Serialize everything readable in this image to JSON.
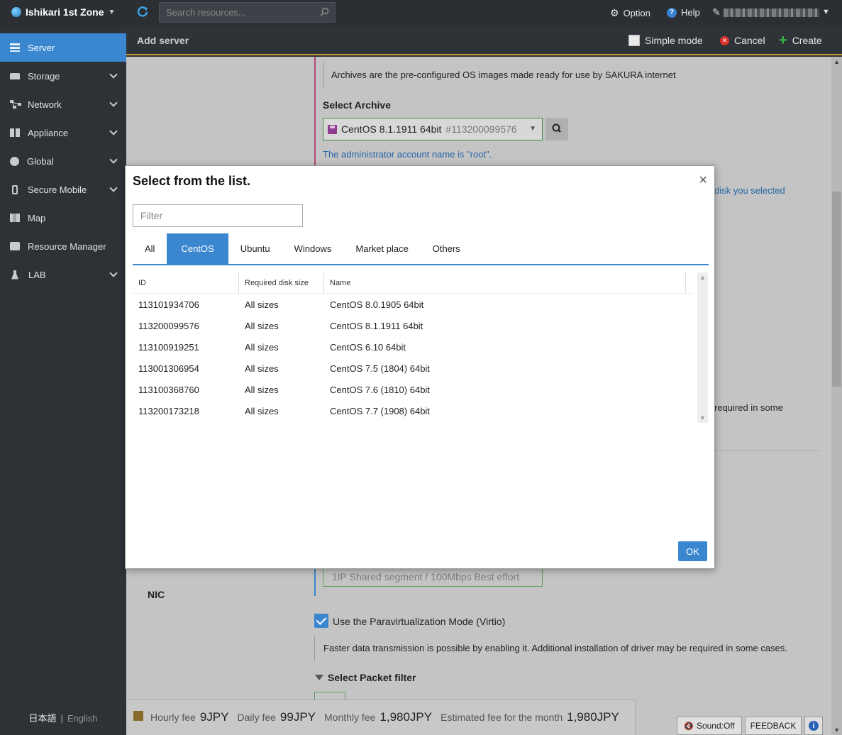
{
  "topbar": {
    "zone": "Ishikari 1st Zone",
    "search_placeholder": "Search resources...",
    "option": "Option",
    "help": "Help"
  },
  "sidebar": {
    "items": [
      {
        "label": "Server",
        "icon": "server-icon"
      },
      {
        "label": "Storage",
        "icon": "storage-icon"
      },
      {
        "label": "Network",
        "icon": "network-icon"
      },
      {
        "label": "Appliance",
        "icon": "appliance-icon"
      },
      {
        "label": "Global",
        "icon": "globe-icon"
      },
      {
        "label": "Secure Mobile",
        "icon": "mobile-icon"
      },
      {
        "label": "Map",
        "icon": "map-icon"
      },
      {
        "label": "Resource Manager",
        "icon": "puzzle-icon"
      },
      {
        "label": "LAB",
        "icon": "flask-icon"
      }
    ],
    "lang_ja": "日本語",
    "lang_sep": "|",
    "lang_en": "English"
  },
  "header": {
    "title": "Add server",
    "simple_mode": "Simple mode",
    "cancel": "Cancel",
    "create": "Create"
  },
  "page": {
    "archive_note": "Archives are the pre-configured OS images made ready for use by SAKURA internet",
    "select_archive_label": "Select Archive",
    "archive_selected_name": "CentOS 8.1.1911 64bit",
    "archive_selected_id": "#113200099576",
    "admin_note": "The administrator account name is \"root\".",
    "disk_note_partial": "disk you selected",
    "required_note_partial": "required in some",
    "segment_value": "1IP Shared segment / 100Mbps Best effort",
    "nic_label": "NIC",
    "virtio_label": "Use the Paravirtualization Mode (Virtio)",
    "virtio_note": "Faster data transmission is possible by enabling it. Additional installation of driver may be required in some cases.",
    "packet_filter_label": "Select Packet filter"
  },
  "fees": {
    "hourly_label": "Hourly fee",
    "hourly_value": "9JPY",
    "daily_label": "Daily fee",
    "daily_value": "99JPY",
    "monthly_label": "Monthly fee",
    "monthly_value": "1,980JPY",
    "estimated_label": "Estimated fee for the month",
    "estimated_value": "1,980JPY"
  },
  "bottom_buttons": {
    "sound": "Sound:Off",
    "feedback": "FEEDBACK"
  },
  "modal": {
    "title": "Select from the list.",
    "close": "×",
    "filter_placeholder": "Filter",
    "tabs": [
      "All",
      "CentOS",
      "Ubuntu",
      "Windows",
      "Market place",
      "Others"
    ],
    "active_tab": "CentOS",
    "columns": [
      "ID",
      "Required disk size",
      "Name"
    ],
    "rows": [
      {
        "id": "113101934706",
        "size": "All sizes",
        "name": "CentOS 8.0.1905 64bit"
      },
      {
        "id": "113200099576",
        "size": "All sizes",
        "name": "CentOS 8.1.1911 64bit"
      },
      {
        "id": "113100919251",
        "size": "All sizes",
        "name": "CentOS 6.10 64bit"
      },
      {
        "id": "113001306954",
        "size": "All sizes",
        "name": "CentOS 7.5 (1804) 64bit"
      },
      {
        "id": "113100368760",
        "size": "All sizes",
        "name": "CentOS 7.6 (1810) 64bit"
      },
      {
        "id": "113200173218",
        "size": "All sizes",
        "name": "CentOS 7.7 (1908) 64bit"
      }
    ],
    "ok": "OK"
  },
  "colors": {
    "accent": "#3a87cf",
    "sidebar_bg": "#2d3237",
    "header_border": "#c59b3f",
    "create_green": "#39b54a",
    "cancel_red": "#d9302c"
  }
}
